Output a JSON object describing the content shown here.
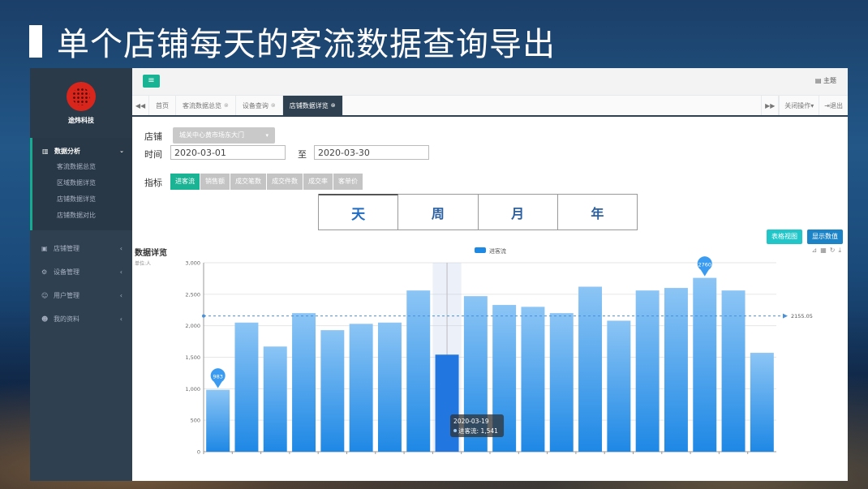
{
  "slide": {
    "title": "单个店铺每天的客流数据查询导出"
  },
  "sidebar": {
    "brand": "途炜科技",
    "group": {
      "label": "数据分析",
      "items": [
        "客流数据总览",
        "区域数据详览",
        "店铺数据详览",
        "店铺数据对比"
      ]
    },
    "items": [
      {
        "label": "店铺管理",
        "icon": "store-icon"
      },
      {
        "label": "设备管理",
        "icon": "device-icon"
      },
      {
        "label": "用户管理",
        "icon": "users-icon"
      },
      {
        "label": "我的资料",
        "icon": "profile-icon"
      }
    ]
  },
  "topbar": {
    "menu_icon": "≡",
    "theme_label": "主题"
  },
  "tabs": {
    "items": [
      "首页",
      "客流数据总览",
      "设备查询",
      "店铺数据详览"
    ],
    "active_index": 3,
    "close_ops": "关闭操作",
    "logout": "退出"
  },
  "form": {
    "store_label": "店铺",
    "store_value": "城关中心黄市场东大门",
    "time_label": "时间",
    "date_from": "2020-03-01",
    "to_label": "至",
    "date_to": "2020-03-30",
    "metric_label": "指标",
    "metrics": [
      "进客流",
      "销售额",
      "成交笔数",
      "成交件数",
      "成交率",
      "客单价"
    ],
    "active_metric": 0,
    "periods": [
      "天",
      "周",
      "月",
      "年"
    ],
    "active_period": 0
  },
  "buttons": {
    "table_view": "表格视图",
    "show_values": "显示数值"
  },
  "chart_header": {
    "title": "数据详览",
    "unit": "单位:人"
  },
  "colors": {
    "accent": "#1ab394",
    "sidebar": "#2f4050",
    "bar_top": "#8cc5f5",
    "bar_bottom": "#1e88e5",
    "bar_highlight": "#2176e0"
  },
  "chart_data": {
    "type": "bar",
    "series": [
      {
        "name": "进客流",
        "values": [
          983,
          2050,
          1670,
          2200,
          1930,
          2030,
          2050,
          2560,
          1541,
          2470,
          2330,
          2300,
          2200,
          2620,
          2080,
          2560,
          2600,
          2760,
          2560,
          1570
        ]
      }
    ],
    "ylim": [
      0,
      3000
    ],
    "yticks": [
      "0",
      "500",
      "1,000",
      "1,500",
      "2,000",
      "2,500",
      "3,000"
    ],
    "average": 2155.05,
    "average_label": "2155.05",
    "max_label": "2760",
    "min_label": "983",
    "highlight_index": 8,
    "tooltip": {
      "date": "2020-03-19",
      "series": "进客流",
      "value": "1,541"
    },
    "legend_position": "top-center",
    "grid": true
  }
}
